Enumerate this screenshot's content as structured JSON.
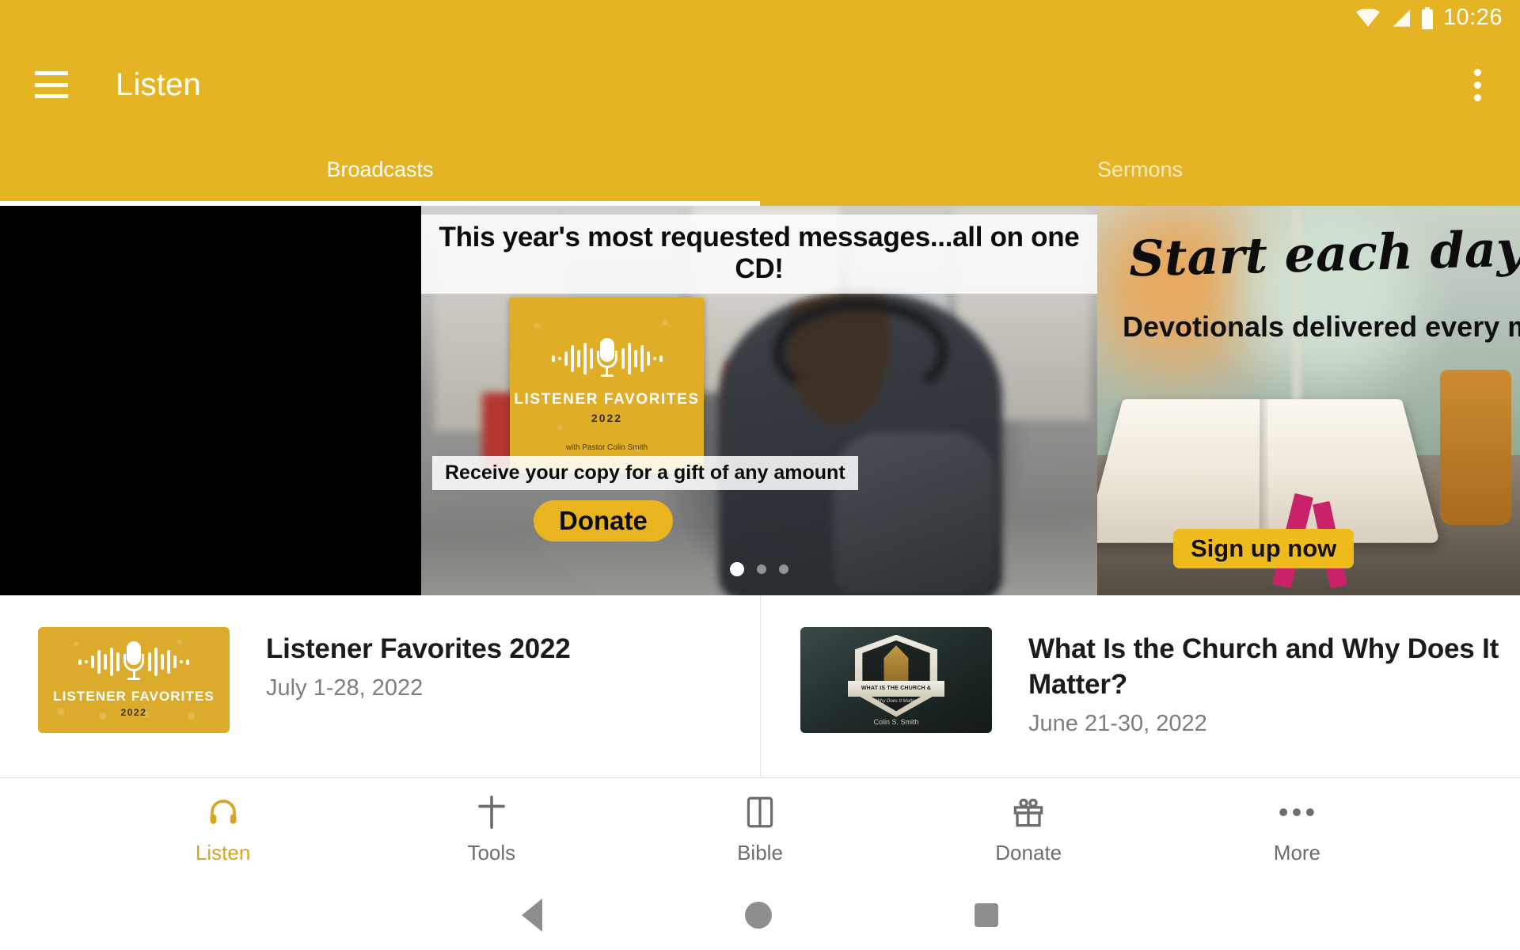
{
  "status_bar": {
    "time": "10:26",
    "icons": [
      "wifi-icon",
      "cellular-signal-icon",
      "battery-icon"
    ]
  },
  "app_bar": {
    "menu_icon": "hamburger-menu-icon",
    "title": "Listen",
    "overflow_icon": "overflow-menu-icon"
  },
  "tabs": {
    "items": [
      {
        "label": "Broadcasts",
        "active": true
      },
      {
        "label": "Sermons",
        "active": false
      }
    ]
  },
  "carousel": {
    "slides": [
      {
        "id": "blank-slide",
        "type": "blank"
      },
      {
        "id": "listener-favorites-promo",
        "headline": "This year's most requested messages...all on one CD!",
        "subline": "Receive your copy for a gift of any amount",
        "cta_label": "Donate",
        "album_art": {
          "title": "LISTENER FAVORITES",
          "year": "2022",
          "byline": "with Pastor Colin Smith",
          "icon": "microphone-waveform-icon"
        }
      },
      {
        "id": "devotionals-promo",
        "headline": "Start each day in C",
        "subline": "Devotionals delivered every mor",
        "cta_label": "Sign up now"
      }
    ],
    "dots": {
      "count": 3,
      "active_index": 0
    }
  },
  "list": {
    "items": [
      {
        "title": "Listener Favorites 2022",
        "date": "July 1-28, 2022",
        "thumbnail": {
          "type": "listener-favorites",
          "title": "LISTENER FAVORITES",
          "year": "2022",
          "icon": "microphone-waveform-icon"
        }
      },
      {
        "title": "What Is the Church and Why Does It Matter?",
        "date": "June 21-30, 2022",
        "thumbnail": {
          "type": "what-is-the-church",
          "band": "WHAT IS THE CHURCH &",
          "script": "Why Does It Matter",
          "author": "Colin S. Smith",
          "icon": "church-shield-badge-icon"
        }
      }
    ]
  },
  "bottom_nav": {
    "items": [
      {
        "label": "Listen",
        "icon": "headphones-icon",
        "active": true
      },
      {
        "label": "Tools",
        "icon": "cross-icon",
        "active": false
      },
      {
        "label": "Bible",
        "icon": "book-icon",
        "active": false
      },
      {
        "label": "Donate",
        "icon": "gift-icon",
        "active": false
      },
      {
        "label": "More",
        "icon": "ellipsis-icon",
        "active": false
      }
    ]
  },
  "android_nav": {
    "back": "back-triangle-icon",
    "home": "home-circle-icon",
    "recents": "recents-square-icon"
  },
  "colors": {
    "brand_yellow": "#E5B424",
    "accent_yellow": "#D9A520",
    "nav_inactive": "#6d6d6d",
    "date_text": "#7e7e7e"
  }
}
